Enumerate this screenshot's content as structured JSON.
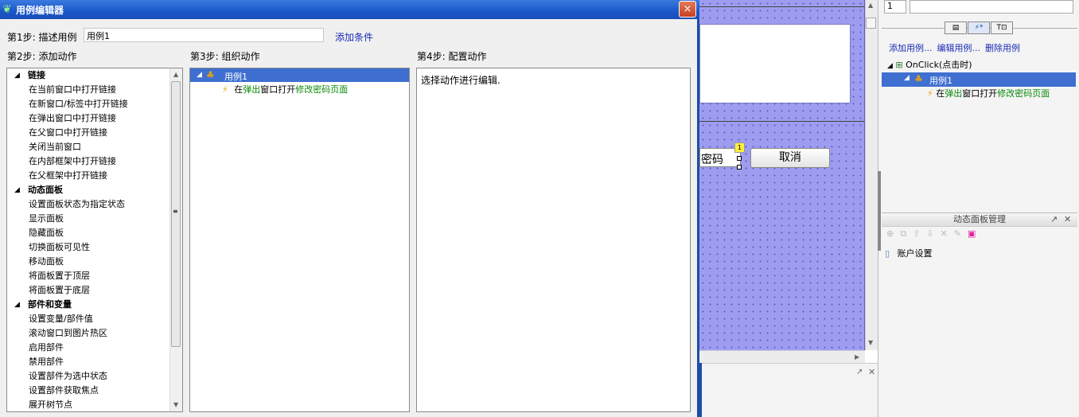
{
  "dialog": {
    "title": "用例编辑器",
    "close": "×",
    "step1_label": "第1步: 描述用例",
    "case_name": "用例1",
    "add_condition": "添加条件",
    "step2_label": "第2步: 添加动作",
    "step3_label": "第3步: 组织动作",
    "step4_label": "第4步: 配置动作",
    "configure_hint": "选择动作进行编辑."
  },
  "actions": {
    "cat_links": "链接",
    "link_items": [
      "在当前窗口中打开链接",
      "在新窗口/标签中打开链接",
      "在弹出窗口中打开链接",
      "在父窗口中打开链接",
      "关闭当前窗口",
      "在内部框架中打开链接",
      "在父框架中打开链接"
    ],
    "cat_panels": "动态面板",
    "panel_items": [
      "设置面板状态为指定状态",
      "显示面板",
      "隐藏面板",
      "切换面板可见性",
      "移动面板",
      "将面板置于顶层",
      "将面板置于底层"
    ],
    "cat_widgets": "部件和变量",
    "widget_items": [
      "设置变量/部件值",
      "滚动窗口到图片热区",
      "启用部件",
      "禁用部件",
      "设置部件为选中状态",
      "设置部件获取焦点",
      "展开树节点"
    ]
  },
  "organize": {
    "case": "用例1",
    "action_prefix": "在",
    "action_popup": "弹出",
    "action_mid": "窗口打开",
    "action_target": "修改密码页面"
  },
  "canvas": {
    "pwd_text": "密码",
    "cancel": "取消",
    "badge": "1"
  },
  "right_panel": {
    "field_value": "1",
    "tab1": "▤",
    "tab2": "⚡*",
    "tab3": "T⊡",
    "link_add": "添加用例...",
    "link_edit": "编辑用例...",
    "link_delete": "删除用例",
    "onclick": "OnClick(点击时)",
    "case": "用例1",
    "action_prefix": "在",
    "action_popup": "弹出",
    "action_mid": "窗口打开",
    "action_target": "修改密码页面",
    "dp_title": "动态面板管理",
    "dp_item": "账户设置"
  }
}
